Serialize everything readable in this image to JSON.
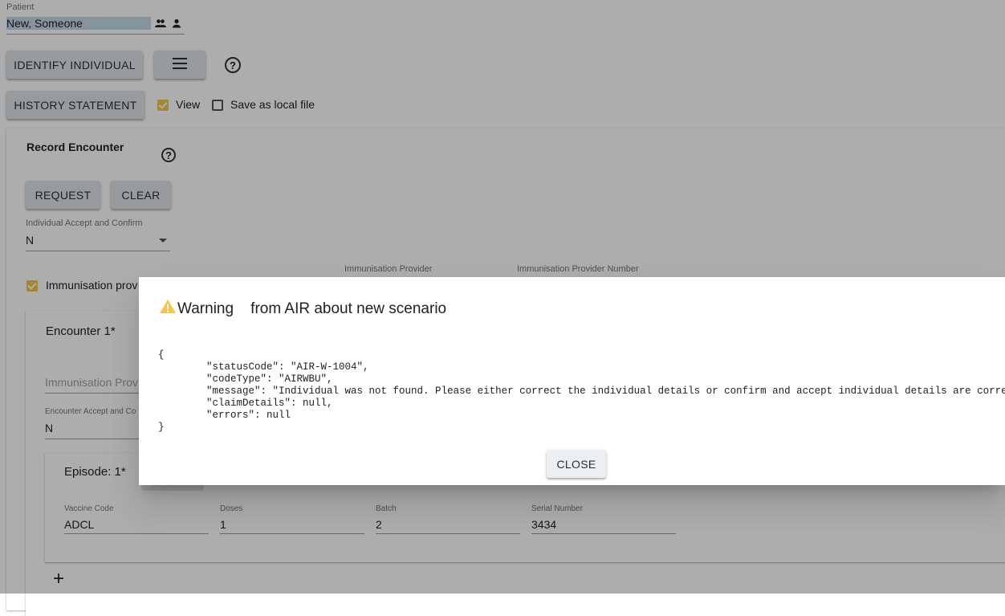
{
  "patient": {
    "label": "Patient",
    "value": "New, Someone"
  },
  "top_buttons": {
    "identify": "IDENTIFY INDIVIDUAL",
    "history": "HISTORY STATEMENT"
  },
  "history_options": {
    "view_label": "View",
    "view_checked": true,
    "save_label": "Save as local file",
    "save_checked": false
  },
  "record_encounter": {
    "title": "Record Encounter",
    "request_label": "REQUEST",
    "clear_label": "CLEAR",
    "accept_label": "Individual Accept and Confirm",
    "accept_value": "N",
    "immunisation_checkbox_label": "Immunisation prov",
    "provider_label": "Immunisation Provider",
    "provider_number_label": "Immunisation Provider Number"
  },
  "encounter": {
    "title": "Encounter 1*",
    "provider_placeholder": "Immunisation Prov",
    "accept_label": "Encounter Accept and Co",
    "accept_value": "N",
    "episode": {
      "title": "Episode: 1*",
      "fields": [
        {
          "label": "Vaccine Code",
          "value": "ADCL"
        },
        {
          "label": "Doses",
          "value": "1"
        },
        {
          "label": "Batch",
          "value": "2"
        },
        {
          "label": "Serial Number",
          "value": "3434"
        }
      ]
    },
    "add_symbol": "+"
  },
  "dialog": {
    "title": "Warning    from AIR about new scenario",
    "body": "{\n\t\"statusCode\": \"AIR-W-1004\",\n\t\"codeType\": \"AIRWBU\",\n\t\"message\": \"Individual was not found. Please either correct the individual details or confirm and accept individual details are correct.\",\n\t\"claimDetails\": null,\n\t\"errors\": null\n}",
    "close_label": "CLOSE"
  },
  "colors": {
    "accent": "#f6c64a",
    "button_bg": "#dfe5e8",
    "selection": "#c5d9e8"
  }
}
